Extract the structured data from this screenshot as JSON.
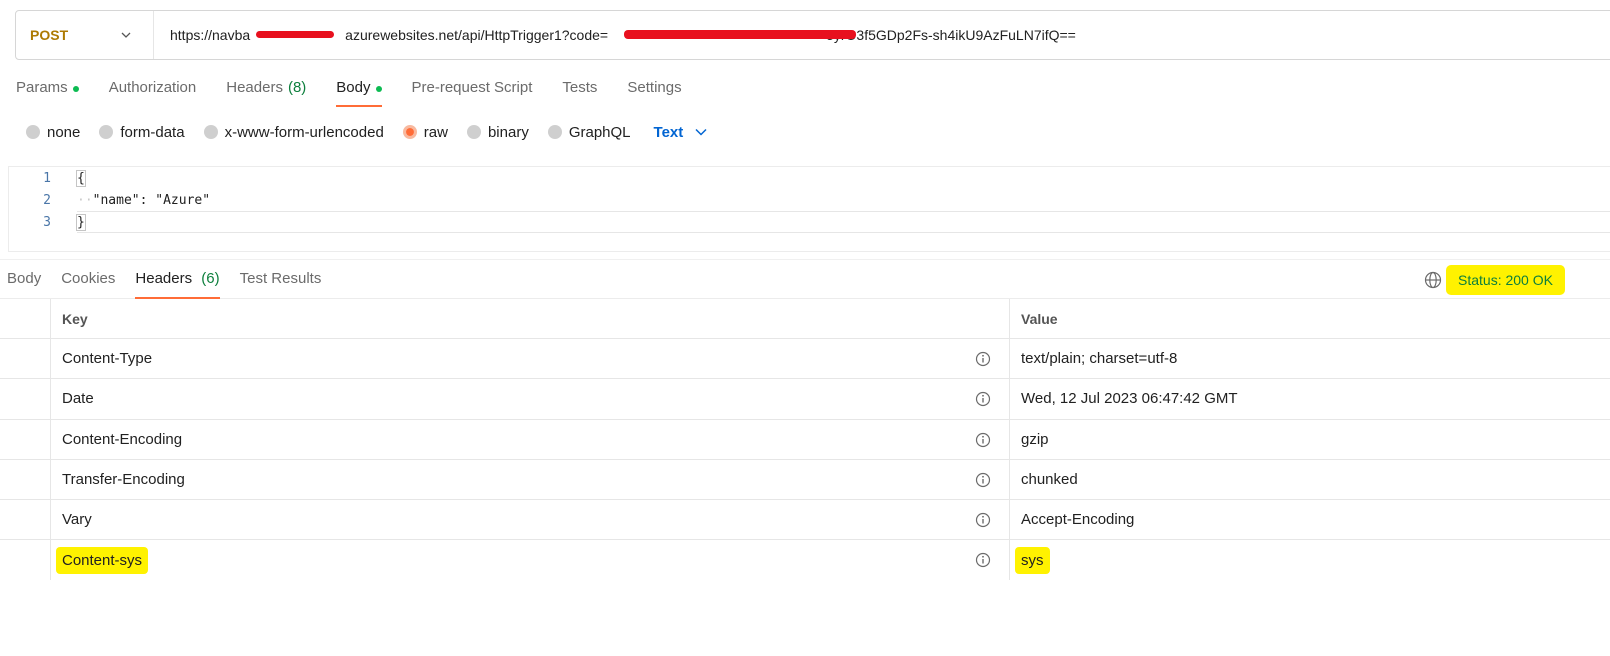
{
  "request": {
    "method": "POST",
    "url_prefix": "https://navba",
    "url_mid": "azurewebsites.net/api/HttpTrigger1?code=",
    "url_suffix": "5yrO3f5GDp2Fs-sh4ikU9AzFuLN7ifQ=="
  },
  "req_tabs": [
    {
      "label": "Params",
      "dot": true
    },
    {
      "label": "Authorization"
    },
    {
      "label": "Headers",
      "count": "(8)"
    },
    {
      "label": "Body",
      "dot": true,
      "active": true
    },
    {
      "label": "Pre-request Script"
    },
    {
      "label": "Tests"
    },
    {
      "label": "Settings"
    }
  ],
  "body_types": [
    "none",
    "form-data",
    "x-www-form-urlencoded",
    "raw",
    "binary",
    "GraphQL"
  ],
  "body_type_selected": "raw",
  "body_format": "Text",
  "editor": {
    "lines": [
      {
        "n": "1",
        "text": "{"
      },
      {
        "n": "2",
        "text": "\"name\": \"Azure\""
      },
      {
        "n": "3",
        "text": "}"
      }
    ]
  },
  "resp_tabs": [
    {
      "label": "Body"
    },
    {
      "label": "Cookies"
    },
    {
      "label": "Headers",
      "count": "(6)",
      "active": true
    },
    {
      "label": "Test Results"
    }
  ],
  "status": "Status: 200 OK",
  "headers_table": {
    "col_key": "Key",
    "col_value": "Value",
    "rows": [
      {
        "key": "Content-Type",
        "value": "text/plain; charset=utf-8"
      },
      {
        "key": "Date",
        "value": "Wed, 12 Jul 2023 06:47:42 GMT"
      },
      {
        "key": "Content-Encoding",
        "value": "gzip"
      },
      {
        "key": "Transfer-Encoding",
        "value": "chunked"
      },
      {
        "key": "Vary",
        "value": "Accept-Encoding"
      },
      {
        "key": "Content-sys",
        "value": "sys"
      }
    ]
  },
  "colors": {
    "accent": "#ff6c37",
    "method": "#ad7a03",
    "success": "#0c7f3c",
    "highlight": "#fff200",
    "link": "#0265d2"
  }
}
